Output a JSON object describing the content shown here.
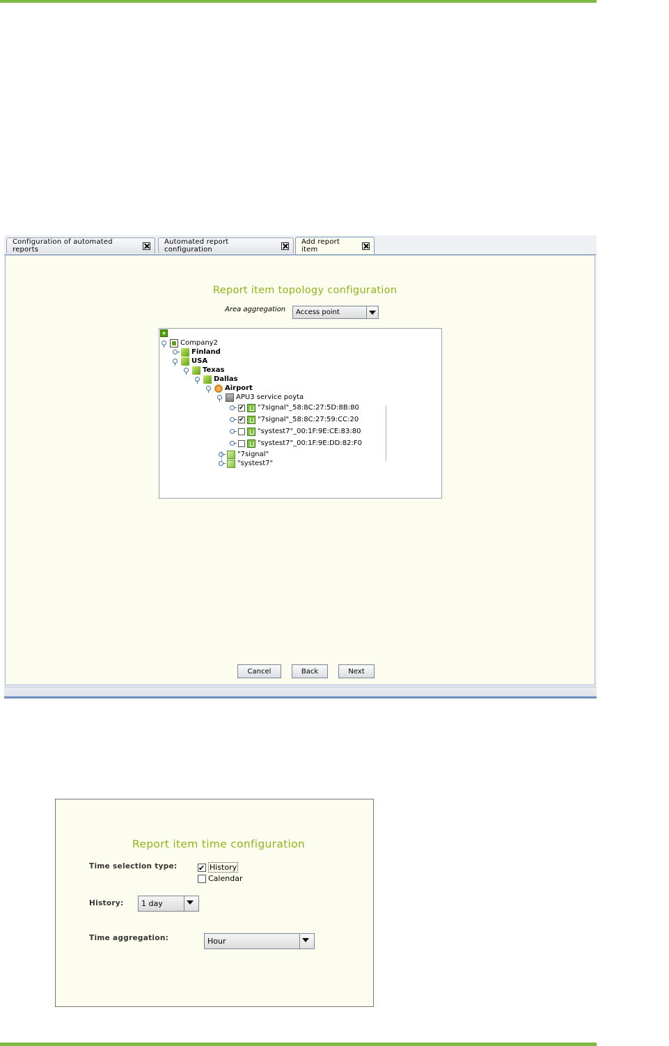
{
  "colors": {
    "rule_green": "#7dbb42",
    "title_green": "#8fb31a",
    "pane_bg": "#fdfdef",
    "accent_blue": "#6c8fbf"
  },
  "top_window": {
    "tabs": [
      {
        "label": "Configuration of automated reports"
      },
      {
        "label": "Automated report configuration"
      },
      {
        "label": "Add report item"
      }
    ],
    "title": "Report item topology configuration",
    "area_aggregation": {
      "label": "Area aggregation",
      "value": "Access point"
    },
    "tree": {
      "nodes": [
        {
          "label": "Company2",
          "icon": "company-icon"
        },
        {
          "label": "Finland",
          "icon": "building-icon"
        },
        {
          "label": "USA",
          "icon": "building-icon"
        },
        {
          "label": "Texas",
          "icon": "building-icon"
        },
        {
          "label": "Dallas",
          "icon": "building-icon"
        },
        {
          "label": "Airport",
          "icon": "location-icon"
        },
        {
          "label": "APU3 service poyta",
          "icon": "floor-icon"
        },
        {
          "label": "\"7signal\"_58:8C:27:5D:8B:80",
          "icon": "access-point-icon",
          "checked": true
        },
        {
          "label": "\"7signal\"_58:8C:27:59:CC:20",
          "icon": "access-point-icon",
          "checked": true
        },
        {
          "label": "\"systest7\"_00:1F:9E:CE:83:80",
          "icon": "access-point-icon",
          "checked": false
        },
        {
          "label": "\"systest7\"_00:1F:9E:DD:82:F0",
          "icon": "access-point-icon",
          "checked": false
        },
        {
          "label": "\"7signal\"",
          "icon": "ssid-icon"
        },
        {
          "label": "\"systest7\"",
          "icon": "ssid-icon"
        }
      ]
    },
    "buttons": {
      "cancel": "Cancel",
      "back": "Back",
      "next": "Next"
    }
  },
  "bottom_panel": {
    "title": "Report item time configuration",
    "time_selection": {
      "label": "Time selection type:",
      "options": [
        {
          "label": "History",
          "checked": true
        },
        {
          "label": "Calendar",
          "checked": false
        }
      ]
    },
    "history": {
      "label": "History:",
      "value": "1 day"
    },
    "time_aggregation": {
      "label": "Time aggregation:",
      "value": "Hour"
    }
  }
}
